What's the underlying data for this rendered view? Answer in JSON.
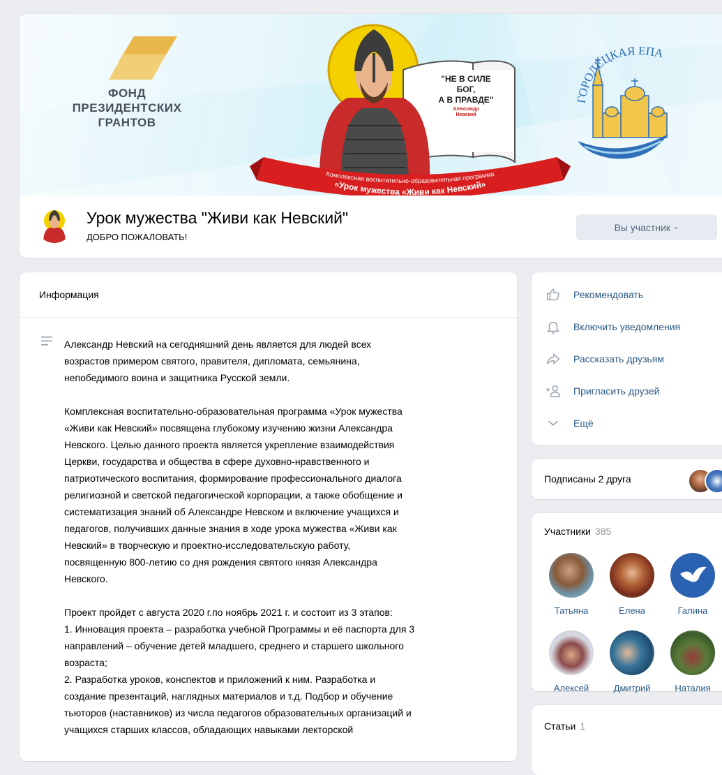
{
  "header": {
    "cover": {
      "fund_logo_text": "ФОНД\nПРЕЗИДЕНТСКИХ\nГРАНТОВ",
      "motto": "\"НЕ В СИЛЕ\nБОГ,\nА В ПРАВДЕ\"",
      "motto_signature": "Александр\nНевский",
      "ribbon_upper": "Комплексная воспитательно-образовательная программа",
      "ribbon_lower": "«Урок мужества «Живи как Невский»",
      "eparchy_text": "ГОРОДЕЦКАЯ ЕПАРХИЯ"
    },
    "title": "Урок мужества \"Живи как Невский\"",
    "status": "ДОБРО ПОЖАЛОВАТЬ!",
    "member_button": "Вы участник"
  },
  "info": {
    "heading": "Информация",
    "description": "Александр Невский на сегодняшний день является для людей всех\nвозрастов примером святого, правителя, дипломата, семьянина,\nнепобедимого воина и защитника Русской земли.\n\nКомплексная воспитательно-образовательная программа «Урок мужества\n«Живи как Невский» посвящена глубокому изучению жизни Александра\nНевского. Целью данного проекта является укрепление взаимодействия\nЦеркви, государства и общества в сфере духовно-нравственного и\nпатриотического воспитания, формирование профессионального диалога\nрелигиозной и светской педагогической корпорации, а также обобщение и\nсистематизация знаний об Александре Невском и включение учащихся и\nпедагогов, получивших данные знания в ходе урока мужества «Живи как\nНевский» в творческую и проектно-исследовательскую работу,\nпосвященную 800-летию со дня рождения святого князя Александра\nНевского.\n\nПроект пройдет с августа 2020 г.по ноябрь 2021 г. и состоит из 3 этапов:\n1. Инновация проекта – разработка учебной Программы и её паспорта для 3\nнаправлений – обучение детей младшего, среднего и старшего школьного\nвозраста;\n2. Разработка уроков, конспектов и приложений к ним. Разработка и\nсоздание презентаций, наглядных материалов и т.д. Подбор и обучение\nтьюторов (наставников) из числа педагогов образовательных организаций и\nучащихся старших классов, обладающих навыками лекторской"
  },
  "actions": [
    {
      "label": "Рекомендовать",
      "icon": "thumbs-up-icon"
    },
    {
      "label": "Включить уведомления",
      "icon": "bell-icon"
    },
    {
      "label": "Рассказать друзьям",
      "icon": "share-icon"
    },
    {
      "label": "Пригласить друзей",
      "icon": "add-user-icon"
    },
    {
      "label": "Ещё",
      "icon": "chevron-down-icon"
    }
  ],
  "friends": {
    "label": "Подписаны 2 друга"
  },
  "members": {
    "label": "Участники",
    "count": "385",
    "list": [
      {
        "name": "Татьяна"
      },
      {
        "name": "Елена"
      },
      {
        "name": "Галина"
      },
      {
        "name": "Алексей"
      },
      {
        "name": "Дмитрий"
      },
      {
        "name": "Наталия"
      }
    ]
  },
  "articles": {
    "label": "Статьи",
    "count": "1"
  },
  "colors": {
    "link": "#2a5885",
    "background": "#ebedf0",
    "button_bg": "#e5ebf1",
    "button_text": "#55677d"
  }
}
